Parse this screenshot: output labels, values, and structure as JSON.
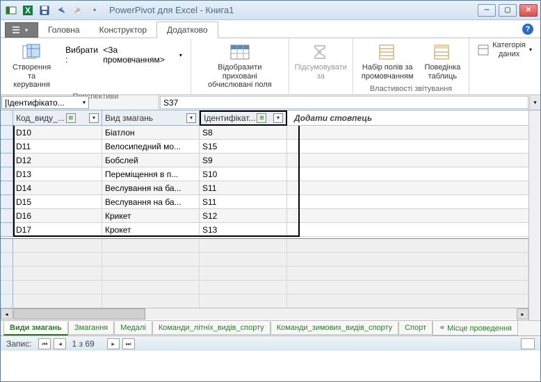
{
  "title": "PowerPivot для Excel - Книга1",
  "tabs": {
    "home": "Головна",
    "design": "Конструктор",
    "advanced": "Додатково"
  },
  "ribbon": {
    "g1": {
      "btn1": "Створення та\nкерування",
      "select_label": "Вибрати :",
      "select_value": "<За промовчанням>",
      "group": "Перспективи"
    },
    "g2": {
      "btn": "Відобразити приховані\nобчислювані поля"
    },
    "g3": {
      "btn": "Підсумовувати\nза"
    },
    "g4": {
      "btn1": "Набір полів за\nпромовчанням",
      "btn2": "Поведінка\nтаблиць",
      "group": "Властивості звітування"
    },
    "g5": {
      "btn": "Категорія даних"
    }
  },
  "formula": {
    "selector": "[Ідентифікато...",
    "value": "S37"
  },
  "columns": {
    "c0": "Код_виду_...",
    "c1": "Вид змагань",
    "c2": "Ідентифікат...",
    "add": "Додати стовпець"
  },
  "rows": [
    {
      "c0": "D10",
      "c1": "Біатлон",
      "c2": "S8"
    },
    {
      "c0": "D11",
      "c1": "Велосипедний мо...",
      "c2": "S15"
    },
    {
      "c0": "D12",
      "c1": "Бобслей",
      "c2": "S9"
    },
    {
      "c0": "D13",
      "c1": "Переміщення в п...",
      "c2": "S10"
    },
    {
      "c0": "D14",
      "c1": "Веслування на ба...",
      "c2": "S11"
    },
    {
      "c0": "D15",
      "c1": "Веслування на ба...",
      "c2": "S11"
    },
    {
      "c0": "D16",
      "c1": "Крикет",
      "c2": "S12"
    },
    {
      "c0": "D17",
      "c1": "Крокет",
      "c2": "S13"
    }
  ],
  "sheets": [
    "Види змагань",
    "Змагання",
    "Медалі",
    "Команди_літніх_видів_спорту",
    "Команди_зимових_видів_спорту",
    "Спорт",
    "Місце проведення"
  ],
  "status": {
    "record": "Запис:",
    "pos": "1 з 69"
  }
}
